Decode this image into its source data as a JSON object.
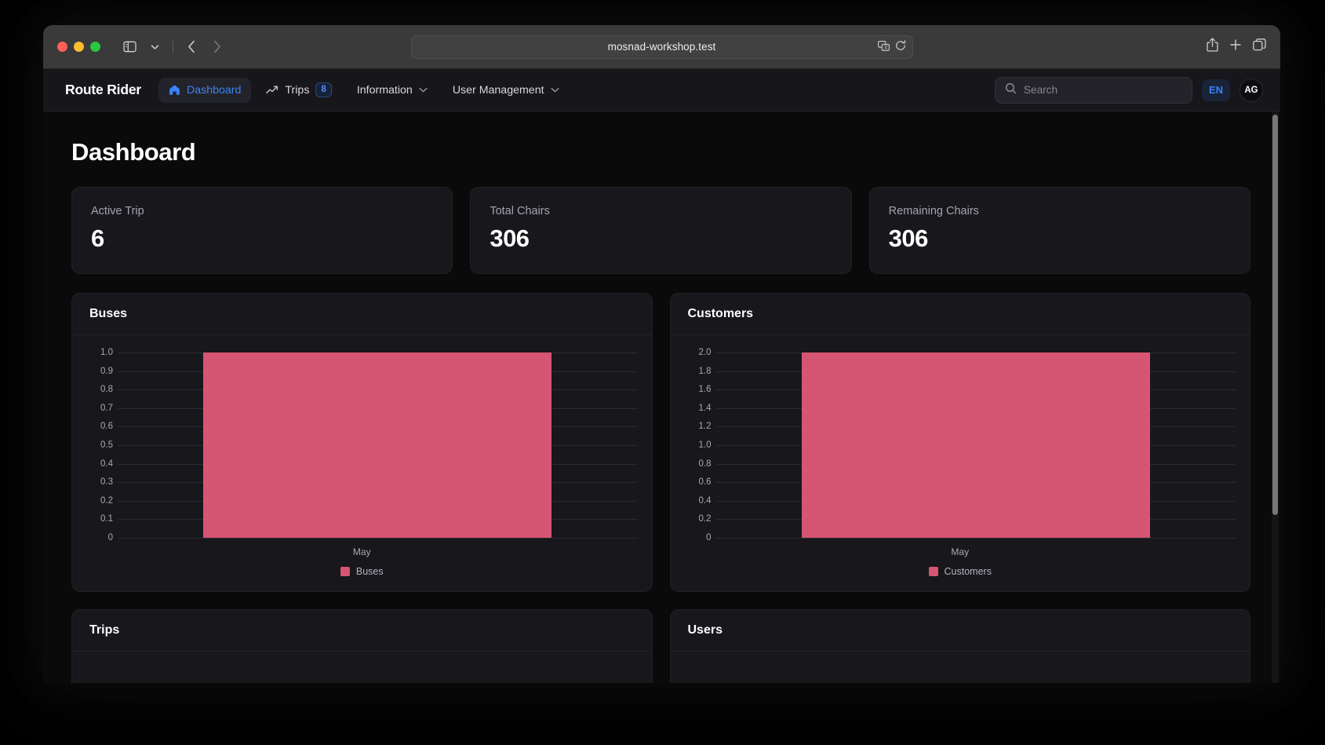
{
  "browser": {
    "url": "mosnad-workshop.test",
    "icons": {
      "sidebar": "sidebar-icon",
      "tab_menu": "chevron-down-icon",
      "back": "back-arrow-icon",
      "forward": "forward-arrow-icon",
      "translate": "translate-icon",
      "reload": "reload-icon",
      "share": "share-icon",
      "new_tab": "plus-icon",
      "tab_overview": "tab-overview-icon"
    }
  },
  "navbar": {
    "brand": "Route Rider",
    "items": [
      {
        "label": "Dashboard",
        "icon": "home-icon",
        "active": true,
        "badge": null,
        "chevron": false
      },
      {
        "label": "Trips",
        "icon": "trending-up-icon",
        "active": false,
        "badge": "8",
        "chevron": false
      },
      {
        "label": "Information",
        "icon": null,
        "active": false,
        "badge": null,
        "chevron": true
      },
      {
        "label": "User Management",
        "icon": null,
        "active": false,
        "badge": null,
        "chevron": true
      }
    ],
    "search": {
      "placeholder": "Search",
      "value": "",
      "icon": "search-icon"
    },
    "language": "EN",
    "avatar": "AG"
  },
  "page": {
    "title": "Dashboard",
    "stats": [
      {
        "label": "Active Trip",
        "value": "6"
      },
      {
        "label": "Total Chairs",
        "value": "306"
      },
      {
        "label": "Remaining Chairs",
        "value": "306"
      }
    ],
    "cards": [
      {
        "title": "Buses"
      },
      {
        "title": "Customers"
      },
      {
        "title": "Trips"
      },
      {
        "title": "Users"
      }
    ]
  },
  "colors": {
    "bar": "#d65572",
    "accent": "#3b82f6",
    "card_bg": "#17171c",
    "page_bg": "#0a0a0a"
  },
  "chart_data": [
    {
      "type": "bar",
      "title": "Buses",
      "categories": [
        "May"
      ],
      "series": [
        {
          "name": "Buses",
          "values": [
            1
          ]
        }
      ],
      "values": [
        1
      ],
      "xlabel": "",
      "ylabel": "",
      "ylim": [
        0,
        1.0
      ],
      "yticks": [
        "1.0",
        "0.9",
        "0.8",
        "0.7",
        "0.6",
        "0.5",
        "0.4",
        "0.3",
        "0.2",
        "0.1",
        "0"
      ],
      "ytick_values": [
        1.0,
        0.9,
        0.8,
        0.7,
        0.6,
        0.5,
        0.4,
        0.3,
        0.2,
        0.1,
        0
      ],
      "grid": true,
      "legend": [
        "Buses"
      ],
      "legend_position": "bottom",
      "color": "#d65572"
    },
    {
      "type": "bar",
      "title": "Customers",
      "categories": [
        "May"
      ],
      "series": [
        {
          "name": "Customers",
          "values": [
            2
          ]
        }
      ],
      "values": [
        2
      ],
      "xlabel": "",
      "ylabel": "",
      "ylim": [
        0,
        2.0
      ],
      "yticks": [
        "2.0",
        "1.8",
        "1.6",
        "1.4",
        "1.2",
        "1.0",
        "0.8",
        "0.6",
        "0.4",
        "0.2",
        "0"
      ],
      "ytick_values": [
        2.0,
        1.8,
        1.6,
        1.4,
        1.2,
        1.0,
        0.8,
        0.6,
        0.4,
        0.2,
        0
      ],
      "grid": true,
      "legend": [
        "Customers"
      ],
      "legend_position": "bottom",
      "color": "#d65572"
    }
  ]
}
